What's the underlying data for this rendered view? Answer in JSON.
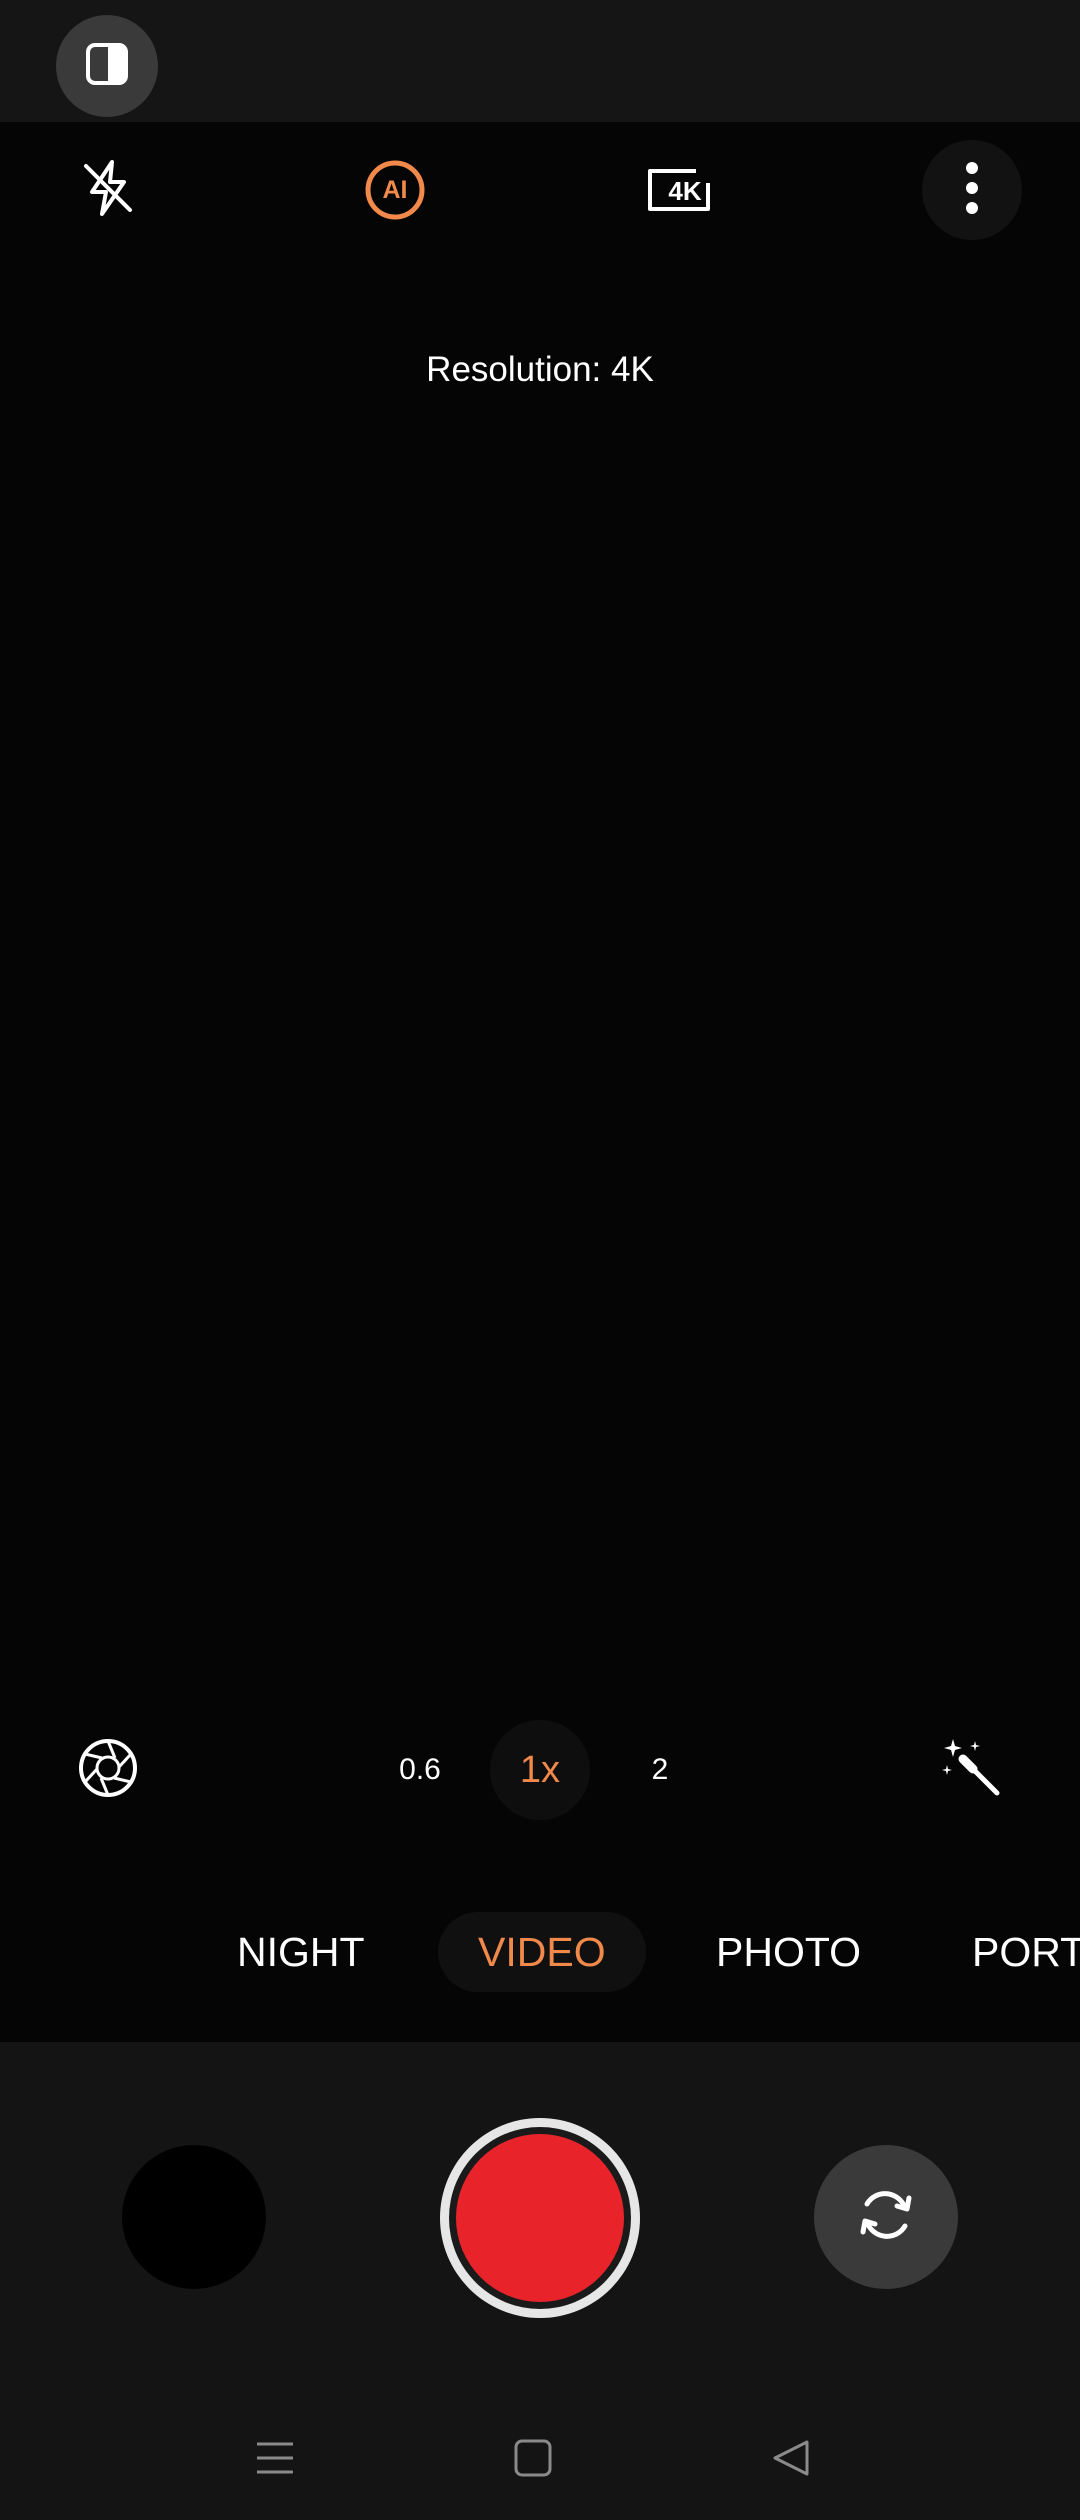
{
  "viewfinder": {
    "resolution_text": "Resolution: 4K"
  },
  "toolbar": {
    "icons": [
      "split-screen-icon",
      "flash-off-icon",
      "ai-scene-icon",
      "4k-resolution-icon",
      "more-options-icon"
    ],
    "ai_label": "AI",
    "res_label": "4K"
  },
  "zoom": {
    "options": [
      "0.6",
      "1x",
      "2"
    ],
    "selected": "1x"
  },
  "modes": {
    "items": [
      "NIGHT",
      "VIDEO",
      "PHOTO",
      "PORT"
    ],
    "selected": "VIDEO"
  },
  "controls": {
    "icons": [
      "aperture-icon",
      "magic-wand-icon",
      "gallery-thumbnail",
      "record-button",
      "switch-camera-icon"
    ]
  },
  "navigation": {
    "icons": [
      "menu-icon",
      "home-icon",
      "back-icon"
    ]
  },
  "colors": {
    "accent": "#f0894a",
    "record": "#e8242a",
    "background": "#111111",
    "viewfinder": "#050505"
  }
}
